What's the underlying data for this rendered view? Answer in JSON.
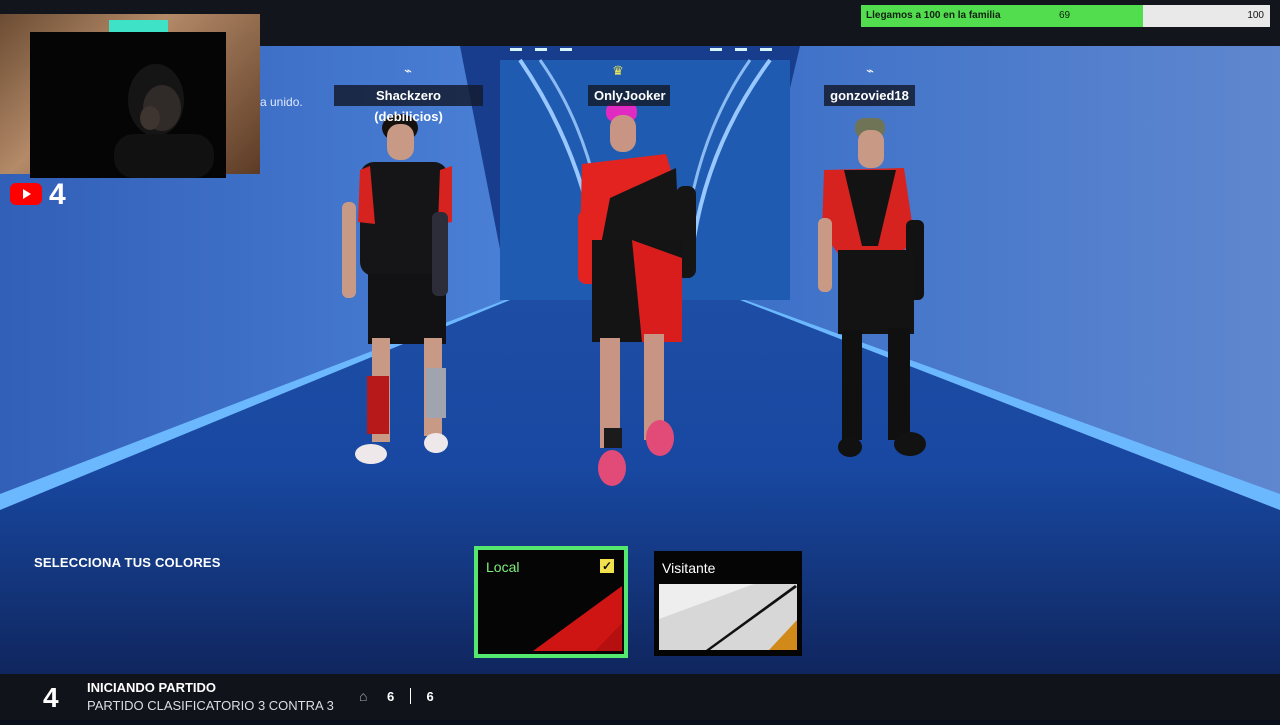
{
  "goal": {
    "label": "Llegamos a 100 en la familia",
    "current": "69",
    "target": "100",
    "progress": 0.69
  },
  "overlay": {
    "youtube_count": "4",
    "joined_text": "a unido."
  },
  "players": [
    {
      "name": "Shackzero (debilicios)",
      "icon": "controller-icon"
    },
    {
      "name": "OnlyJooker",
      "icon": "crown-icon"
    },
    {
      "name": "gonzovied18",
      "icon": "controller-icon"
    }
  ],
  "colors": {
    "title": "SELECCIONA TUS COLORES",
    "local": "Local",
    "visitante": "Visitante",
    "selected_color": "#55e86e"
  },
  "status": {
    "number": "4",
    "title": "INICIANDO PARTIDO",
    "subtitle": "PARTIDO CLASIFICATORIO 3 CONTRA 3",
    "count_a": "6",
    "count_b": "6"
  }
}
